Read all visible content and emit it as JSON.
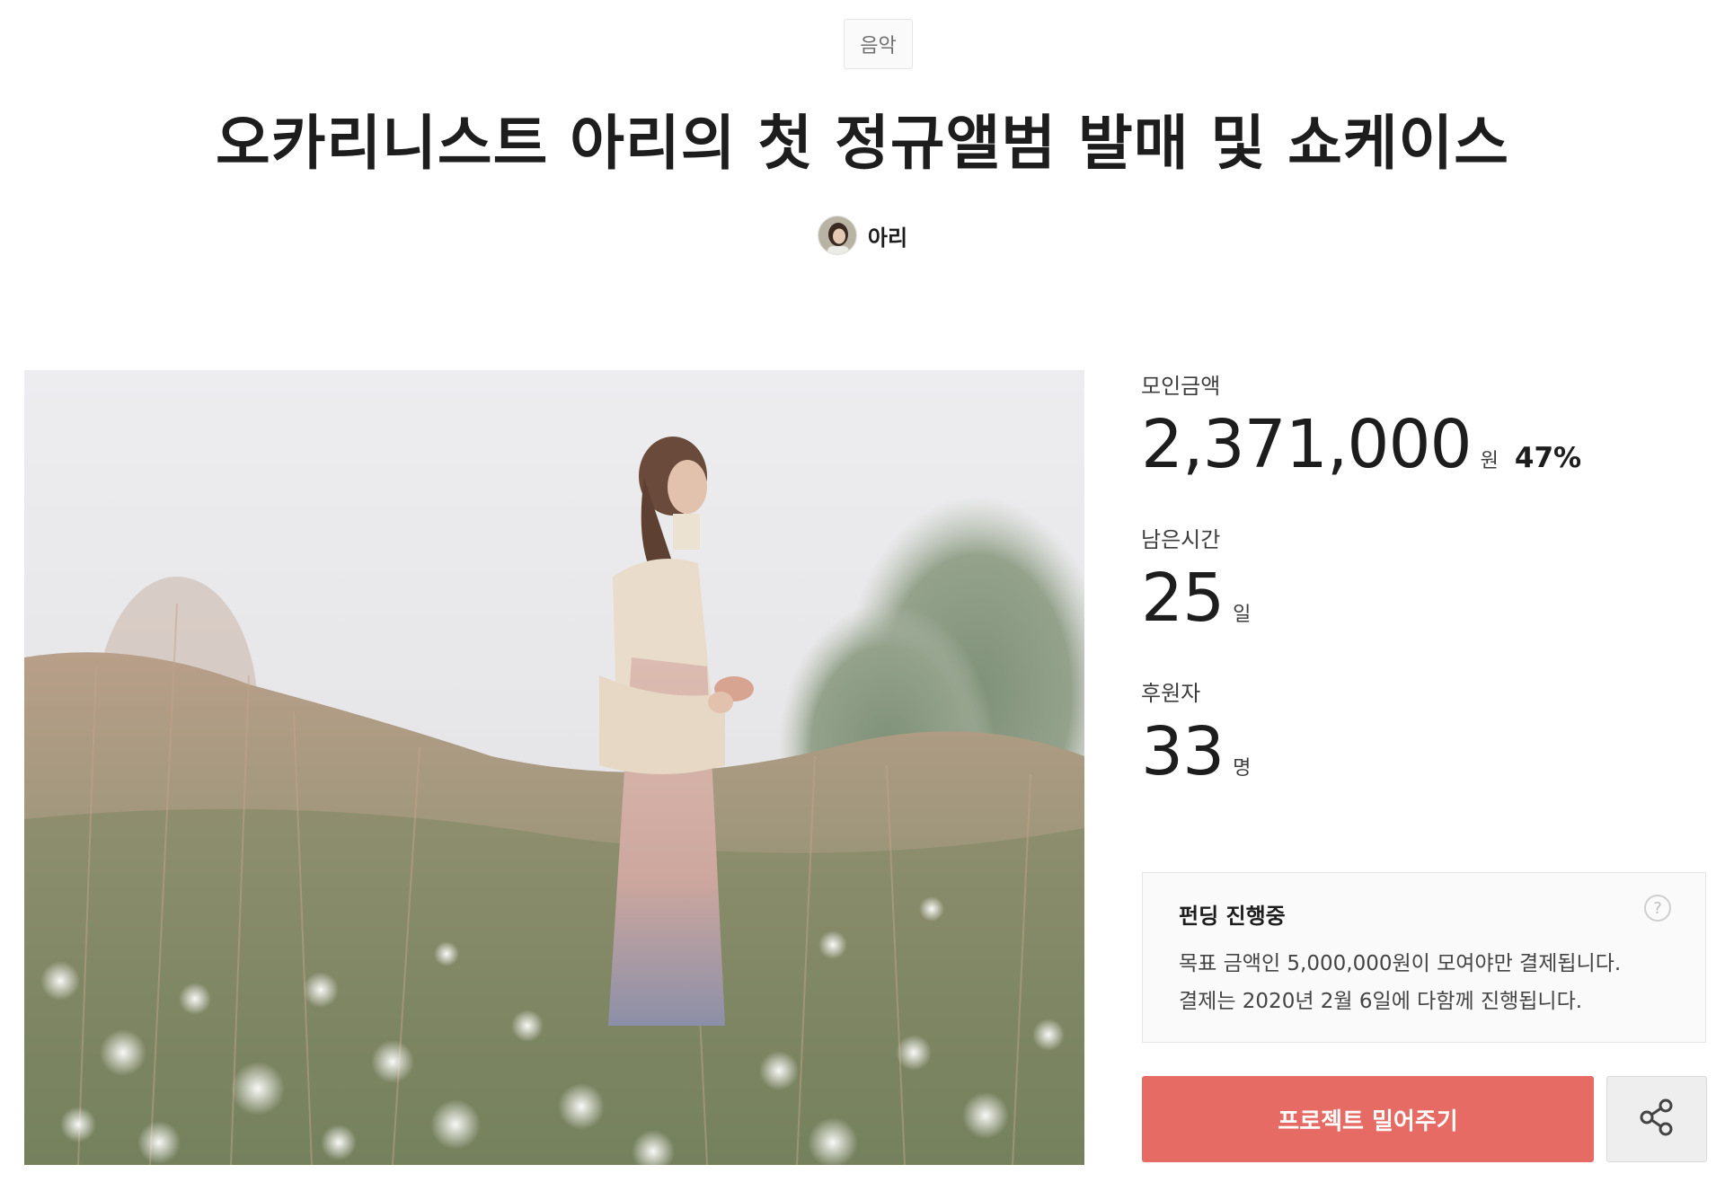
{
  "category": {
    "label": "음악"
  },
  "project": {
    "title": "오카리니스트 아리의 첫 정규앨범 발매 및 쇼케이스",
    "creator_name": "아리"
  },
  "stats": {
    "raised_label": "모인금액",
    "raised_value": "2,371,000",
    "raised_unit": "원",
    "raised_rate": "47%",
    "time_label": "남은시간",
    "time_value": "25",
    "time_unit": "일",
    "backers_label": "후원자",
    "backers_value": "33",
    "backers_unit": "명"
  },
  "notice": {
    "title": "펀딩 진행중",
    "line1": "목표 금액인 5,000,000원이 모여야만 결제됩니다.",
    "line2": "결제는 2020년 2월 6일에 다함께 진행됩니다.",
    "help_symbol": "?"
  },
  "actions": {
    "back_label": "프로젝트 밀어주기"
  },
  "colors": {
    "accent": "#e66b64",
    "text": "#1d1d1d",
    "muted": "#707070"
  },
  "icons": {
    "share": "share-icon",
    "help": "help-icon"
  }
}
